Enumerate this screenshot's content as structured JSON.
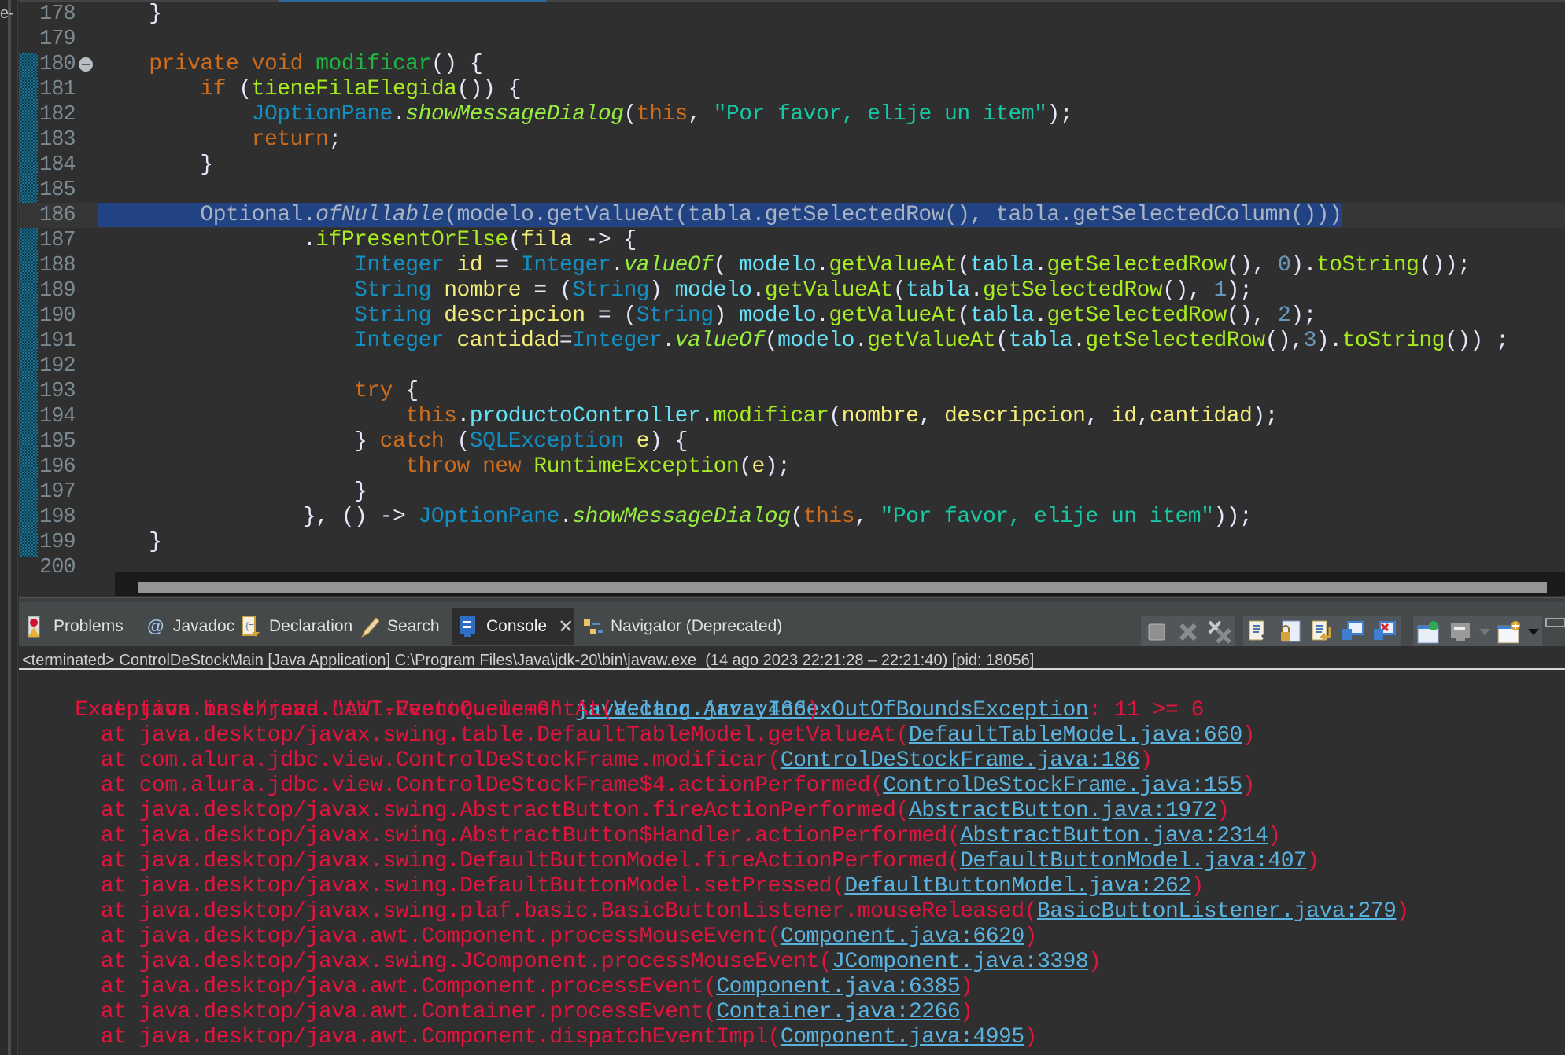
{
  "left_stub_text": "e-",
  "editor": {
    "lines": [
      {
        "n": "178",
        "tokens": [
          [
            "p",
            "    }"
          ]
        ]
      },
      {
        "n": "179",
        "tokens": []
      },
      {
        "n": "180",
        "fold": true,
        "tokens": [
          [
            "p",
            "    "
          ],
          [
            "k",
            "private"
          ],
          [
            "p",
            " "
          ],
          [
            "k",
            "void"
          ],
          [
            "p",
            " "
          ],
          [
            "m",
            "modificar"
          ],
          [
            "p",
            "() {"
          ]
        ]
      },
      {
        "n": "181",
        "tokens": [
          [
            "p",
            "        "
          ],
          [
            "k",
            "if"
          ],
          [
            "p",
            " ("
          ],
          [
            "mc",
            "tieneFilaElegida"
          ],
          [
            "p",
            "()) {"
          ]
        ]
      },
      {
        "n": "182",
        "tokens": [
          [
            "p",
            "            "
          ],
          [
            "t",
            "JOptionPane"
          ],
          [
            "p",
            "."
          ],
          [
            "i",
            "showMessageDialog"
          ],
          [
            "p",
            "("
          ],
          [
            "k",
            "this"
          ],
          [
            "p",
            ", "
          ],
          [
            "s",
            "\"Por favor, elije un item\""
          ],
          [
            "p",
            ");"
          ]
        ]
      },
      {
        "n": "183",
        "tokens": [
          [
            "p",
            "            "
          ],
          [
            "k",
            "return"
          ],
          [
            "p",
            ";"
          ]
        ]
      },
      {
        "n": "184",
        "tokens": [
          [
            "p",
            "        }"
          ]
        ]
      },
      {
        "n": "185",
        "tokens": []
      },
      {
        "n": "186",
        "current": true,
        "selected": true,
        "tokens": [
          [
            "p",
            "        "
          ],
          [
            "selt",
            "Optional."
          ],
          [
            "selti",
            "ofNullable"
          ],
          [
            "selt",
            "(modelo.getValueAt(tabla.getSelectedRow(), tabla.getSelectedColumn()))"
          ]
        ]
      },
      {
        "n": "187",
        "tokens": [
          [
            "p",
            "                ."
          ],
          [
            "mc",
            "ifPresentOrElse"
          ],
          [
            "p",
            "("
          ],
          [
            "v",
            "fila"
          ],
          [
            "p",
            " -> {"
          ]
        ]
      },
      {
        "n": "188",
        "tokens": [
          [
            "p",
            "                    "
          ],
          [
            "t",
            "Integer"
          ],
          [
            "p",
            " "
          ],
          [
            "v",
            "id"
          ],
          [
            "p",
            " = "
          ],
          [
            "t",
            "Integer"
          ],
          [
            "p",
            "."
          ],
          [
            "i",
            "valueOf"
          ],
          [
            "p",
            "( "
          ],
          [
            "f",
            "modelo"
          ],
          [
            "p",
            "."
          ],
          [
            "mc",
            "getValueAt"
          ],
          [
            "p",
            "("
          ],
          [
            "f",
            "tabla"
          ],
          [
            "p",
            "."
          ],
          [
            "mc",
            "getSelectedRow"
          ],
          [
            "p",
            "(), "
          ],
          [
            "n",
            "0"
          ],
          [
            "p",
            ")."
          ],
          [
            "mc",
            "toString"
          ],
          [
            "p",
            "());"
          ]
        ]
      },
      {
        "n": "189",
        "tokens": [
          [
            "p",
            "                    "
          ],
          [
            "t",
            "String"
          ],
          [
            "p",
            " "
          ],
          [
            "v",
            "nombre"
          ],
          [
            "p",
            " = ("
          ],
          [
            "t",
            "String"
          ],
          [
            "p",
            ") "
          ],
          [
            "f",
            "modelo"
          ],
          [
            "p",
            "."
          ],
          [
            "mc",
            "getValueAt"
          ],
          [
            "p",
            "("
          ],
          [
            "f",
            "tabla"
          ],
          [
            "p",
            "."
          ],
          [
            "mc",
            "getSelectedRow"
          ],
          [
            "p",
            "(), "
          ],
          [
            "n",
            "1"
          ],
          [
            "p",
            ");"
          ]
        ]
      },
      {
        "n": "190",
        "tokens": [
          [
            "p",
            "                    "
          ],
          [
            "t",
            "String"
          ],
          [
            "p",
            " "
          ],
          [
            "v",
            "descripcion"
          ],
          [
            "p",
            " = ("
          ],
          [
            "t",
            "String"
          ],
          [
            "p",
            ") "
          ],
          [
            "f",
            "modelo"
          ],
          [
            "p",
            "."
          ],
          [
            "mc",
            "getValueAt"
          ],
          [
            "p",
            "("
          ],
          [
            "f",
            "tabla"
          ],
          [
            "p",
            "."
          ],
          [
            "mc",
            "getSelectedRow"
          ],
          [
            "p",
            "(), "
          ],
          [
            "n",
            "2"
          ],
          [
            "p",
            ");"
          ]
        ]
      },
      {
        "n": "191",
        "tokens": [
          [
            "p",
            "                    "
          ],
          [
            "t",
            "Integer"
          ],
          [
            "p",
            " "
          ],
          [
            "v",
            "cantidad"
          ],
          [
            "p",
            "="
          ],
          [
            "t",
            "Integer"
          ],
          [
            "p",
            "."
          ],
          [
            "i",
            "valueOf"
          ],
          [
            "p",
            "("
          ],
          [
            "f",
            "modelo"
          ],
          [
            "p",
            "."
          ],
          [
            "mc",
            "getValueAt"
          ],
          [
            "p",
            "("
          ],
          [
            "f",
            "tabla"
          ],
          [
            "p",
            "."
          ],
          [
            "mc",
            "getSelectedRow"
          ],
          [
            "p",
            "(),"
          ],
          [
            "n",
            "3"
          ],
          [
            "p",
            ")."
          ],
          [
            "mc",
            "toString"
          ],
          [
            "p",
            "()) ;"
          ]
        ]
      },
      {
        "n": "192",
        "tokens": []
      },
      {
        "n": "193",
        "tokens": [
          [
            "p",
            "                    "
          ],
          [
            "k",
            "try"
          ],
          [
            "p",
            " {"
          ]
        ]
      },
      {
        "n": "194",
        "tokens": [
          [
            "p",
            "                        "
          ],
          [
            "k",
            "this"
          ],
          [
            "p",
            "."
          ],
          [
            "f",
            "productoController"
          ],
          [
            "p",
            "."
          ],
          [
            "mc",
            "modificar"
          ],
          [
            "p",
            "("
          ],
          [
            "v",
            "nombre"
          ],
          [
            "p",
            ", "
          ],
          [
            "v",
            "descripcion"
          ],
          [
            "p",
            ", "
          ],
          [
            "v",
            "id"
          ],
          [
            "p",
            ","
          ],
          [
            "v",
            "cantidad"
          ],
          [
            "p",
            ");"
          ]
        ]
      },
      {
        "n": "195",
        "tokens": [
          [
            "p",
            "                    } "
          ],
          [
            "k",
            "catch"
          ],
          [
            "p",
            " ("
          ],
          [
            "t",
            "SQLException"
          ],
          [
            "p",
            " "
          ],
          [
            "v",
            "e"
          ],
          [
            "p",
            ") {"
          ]
        ]
      },
      {
        "n": "196",
        "tokens": [
          [
            "p",
            "                        "
          ],
          [
            "k",
            "throw"
          ],
          [
            "p",
            " "
          ],
          [
            "k",
            "new"
          ],
          [
            "p",
            " "
          ],
          [
            "mc",
            "RuntimeException"
          ],
          [
            "p",
            "("
          ],
          [
            "v",
            "e"
          ],
          [
            "p",
            ");"
          ]
        ]
      },
      {
        "n": "197",
        "tokens": [
          [
            "p",
            "                    }"
          ]
        ]
      },
      {
        "n": "198",
        "tokens": [
          [
            "p",
            "                }, () -> "
          ],
          [
            "t",
            "JOptionPane"
          ],
          [
            "p",
            "."
          ],
          [
            "i",
            "showMessageDialog"
          ],
          [
            "p",
            "("
          ],
          [
            "k",
            "this"
          ],
          [
            "p",
            ", "
          ],
          [
            "s",
            "\"Por favor, elije un item\""
          ],
          [
            "p",
            "));"
          ]
        ]
      },
      {
        "n": "199",
        "tokens": [
          [
            "p",
            "    }"
          ]
        ]
      },
      {
        "n": "200",
        "tokens": []
      }
    ]
  },
  "panel": {
    "tabs": [
      {
        "label": "Problems",
        "icon": "problems-icon"
      },
      {
        "label": "Javadoc",
        "icon": "javadoc-icon"
      },
      {
        "label": "Declaration",
        "icon": "declaration-icon"
      },
      {
        "label": "Search",
        "icon": "search-icon"
      },
      {
        "label": "Console",
        "icon": "console-icon",
        "active": true,
        "closable": true
      },
      {
        "label": "Navigator (Deprecated)",
        "icon": "navigator-icon"
      }
    ],
    "close_glyph": "✕",
    "toolbar_buttons": [
      "terminate-icon",
      "remove-launch-icon",
      "remove-all-terminated-icon",
      "clear-console-icon",
      "scroll-lock-icon",
      "word-wrap-icon",
      "show-on-stdout-icon",
      "show-on-stderr-icon",
      "pin-console-icon",
      "display-selected-console-icon",
      "open-console-icon"
    ],
    "status_text": "<terminated> ControlDeStockMain [Java Application] C:\\Program Files\\Java\\jdk-20\\bin\\javaw.exe  (14 ago 2023 22:21:28 – 22:21:40) [pid: 18056]"
  },
  "console": {
    "header": {
      "prefix": "Exception in thread \"AWT-EventQueue-0\" ",
      "exception": "java.lang.ArrayIndexOutOfBoundsException",
      "message": ": 11 >= 6"
    },
    "frames": [
      {
        "method": "at java.base/java.util.Vector.elementAt",
        "link": "Vector.java:466"
      },
      {
        "method": "at java.desktop/javax.swing.table.DefaultTableModel.getValueAt",
        "link": "DefaultTableModel.java:660"
      },
      {
        "method": "at com.alura.jdbc.view.ControlDeStockFrame.modificar",
        "link": "ControlDeStockFrame.java:186"
      },
      {
        "method": "at com.alura.jdbc.view.ControlDeStockFrame$4.actionPerformed",
        "link": "ControlDeStockFrame.java:155"
      },
      {
        "method": "at java.desktop/javax.swing.AbstractButton.fireActionPerformed",
        "link": "AbstractButton.java:1972"
      },
      {
        "method": "at java.desktop/javax.swing.AbstractButton$Handler.actionPerformed",
        "link": "AbstractButton.java:2314"
      },
      {
        "method": "at java.desktop/javax.swing.DefaultButtonModel.fireActionPerformed",
        "link": "DefaultButtonModel.java:407"
      },
      {
        "method": "at java.desktop/javax.swing.DefaultButtonModel.setPressed",
        "link": "DefaultButtonModel.java:262"
      },
      {
        "method": "at java.desktop/javax.swing.plaf.basic.BasicButtonListener.mouseReleased",
        "link": "BasicButtonListener.java:279"
      },
      {
        "method": "at java.desktop/java.awt.Component.processMouseEvent",
        "link": "Component.java:6620"
      },
      {
        "method": "at java.desktop/javax.swing.JComponent.processMouseEvent",
        "link": "JComponent.java:3398"
      },
      {
        "method": "at java.desktop/java.awt.Component.processEvent",
        "link": "Component.java:6385"
      },
      {
        "method": "at java.desktop/java.awt.Container.processEvent",
        "link": "Container.java:2266"
      },
      {
        "method": "at java.desktop/java.awt.Component.dispatchEventImpl",
        "link": "Component.java:4995"
      }
    ]
  },
  "colors": {
    "keyword": "#cc6c1d",
    "type": "#1290c3",
    "string": "#17c6a3",
    "error": "#e0143c",
    "link": "#59b3e0",
    "selection": "#214283"
  }
}
